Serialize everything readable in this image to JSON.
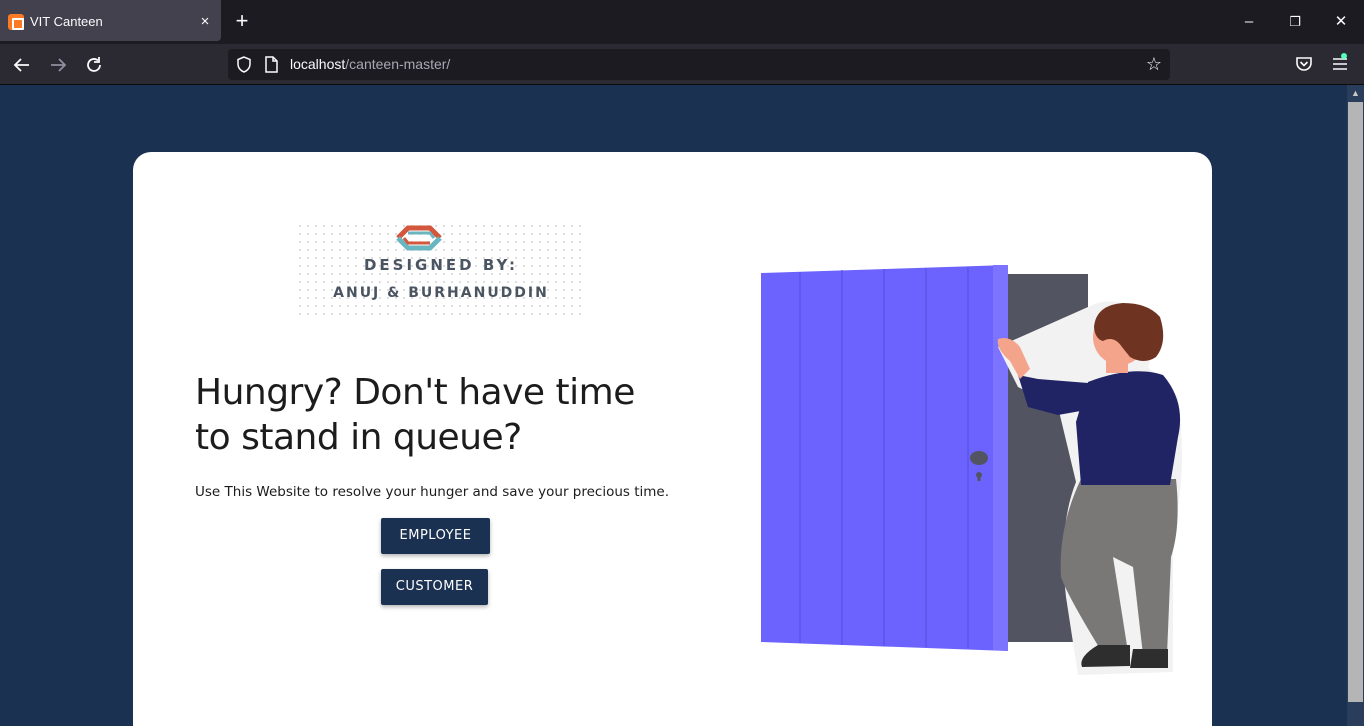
{
  "browser": {
    "tab_title": "VIT Canteen",
    "tab_close": "×",
    "new_tab": "+",
    "url_host": "localhost",
    "url_path": "/canteen-master/",
    "window_controls": {
      "minimize": "–",
      "restore": "❐",
      "close": "✕"
    }
  },
  "page": {
    "logo": {
      "line1": "DESIGNED BY:",
      "line2": "ANUJ & BURHANUDDIN"
    },
    "headline": "Hungry? Don't have time to stand in queue?",
    "subtext": "Use This Website to resolve your hunger and save your precious time.",
    "buttons": {
      "employee": "EMPLOYEE",
      "customer": "CUSTOMER"
    }
  },
  "colors": {
    "page_bg": "#1b3151",
    "card_bg": "#ffffff",
    "button_bg": "#1b3151",
    "door": "#6c63ff",
    "frame": "#535461"
  }
}
